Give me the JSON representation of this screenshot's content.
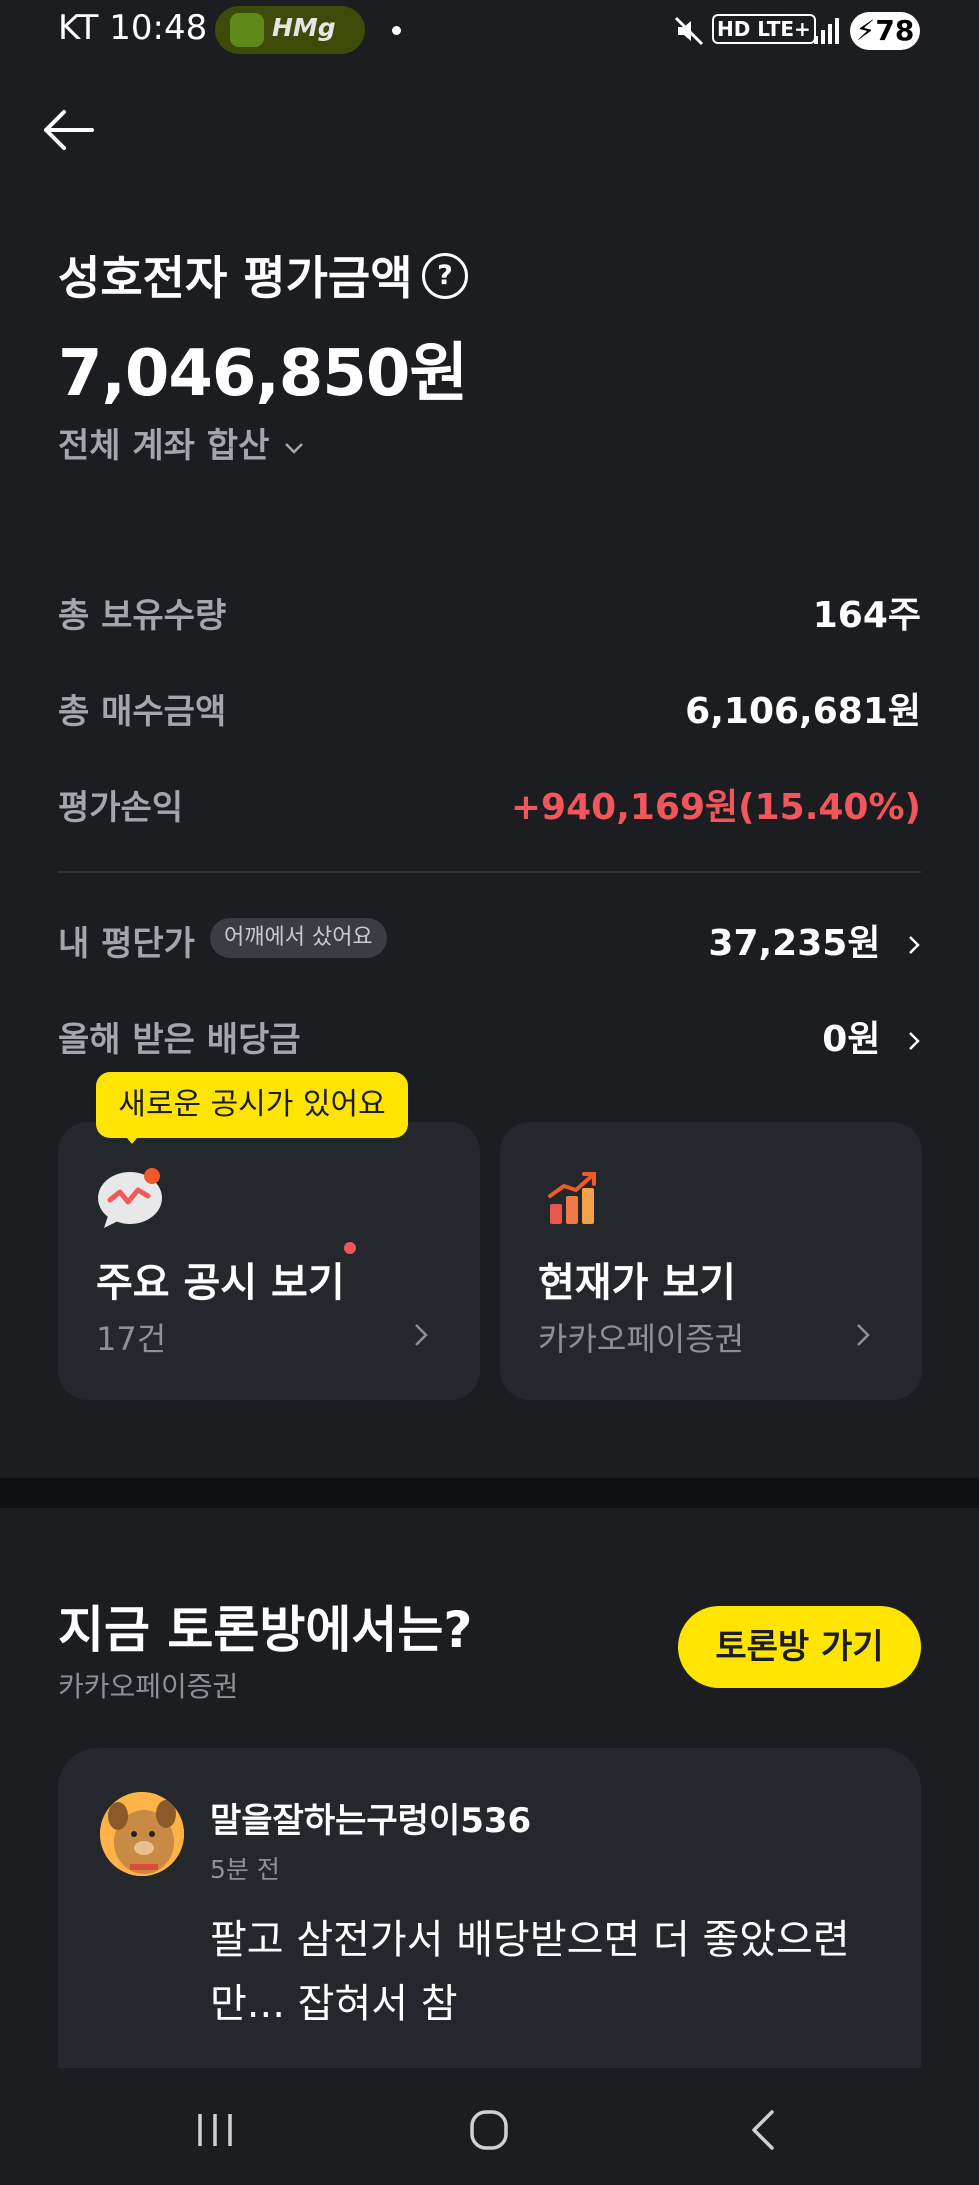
{
  "status_bar": {
    "carrier_time": "KT 10:48",
    "pill_text": "HMg",
    "network": "HD LTE+",
    "battery": "78"
  },
  "header": {
    "title": "성호전자 평가금액",
    "help_glyph": "?",
    "amount": "7,046,850원",
    "account_scope": "전체 계좌 합산"
  },
  "summary": {
    "total_quantity_label": "총 보유수량",
    "total_quantity_value": "164주",
    "total_purchase_label": "총 매수금액",
    "total_purchase_value": "6,106,681원",
    "profit_label": "평가손익",
    "profit_value": "+940,169원(15.40%)",
    "profit_color": "#f0565b",
    "avg_price_label": "내 평단가",
    "avg_price_chip": "어깨에서 샀어요",
    "avg_price_value": "37,235원",
    "dividend_label": "올해 받은 배당금",
    "dividend_value": "0원"
  },
  "tooltip": {
    "text": "새로운 공시가 있어요"
  },
  "cards": [
    {
      "icon": "speech-bubble-chart-icon",
      "title": "주요 공시 보기",
      "subtitle": "17건"
    },
    {
      "icon": "bar-chart-up-icon",
      "title": "현재가 보기",
      "subtitle": "카카오페이증권"
    }
  ],
  "discussion": {
    "title": "지금 토론방에서는?",
    "subtitle": "카카오페이증권",
    "go_button": "토론방 가기",
    "post": {
      "user": "말을잘하는구렁이536",
      "time": "5분 전",
      "text": "팔고 삼전가서 배당받으면 더 좋았으련 만... 잡혀서 참"
    }
  },
  "colors": {
    "background": "#1b1d20",
    "accent_yellow": "#fee500",
    "card": "#24272b"
  }
}
